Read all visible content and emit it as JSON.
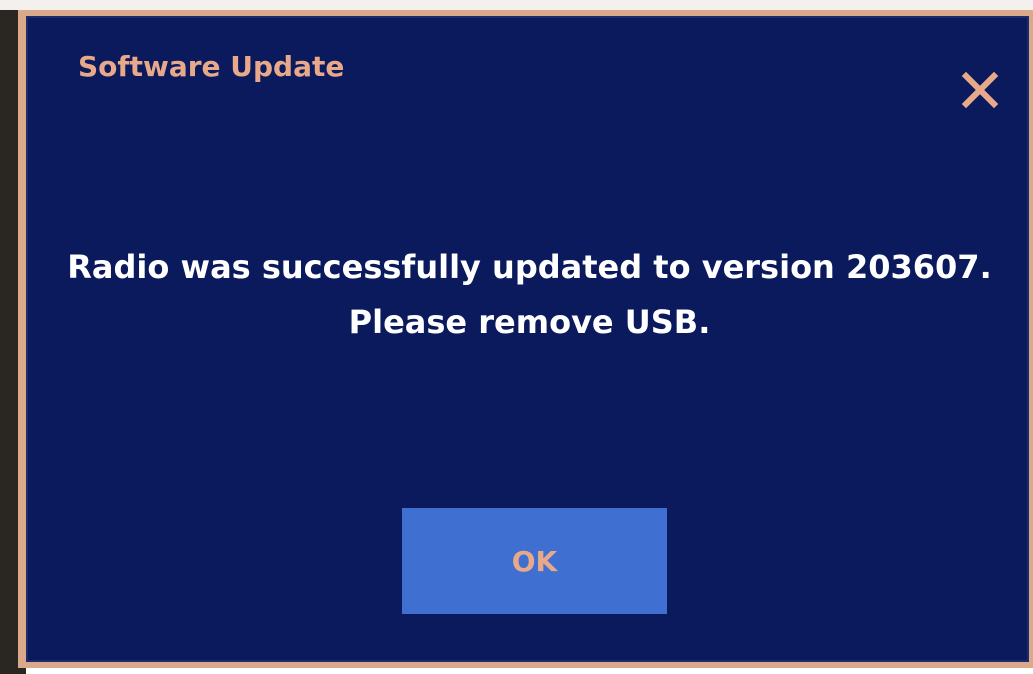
{
  "dialog": {
    "title": "Software Update",
    "message_line1": "Radio was successfully updated to version 203607.",
    "message_line2": "Please remove USB.",
    "ok_label": "OK",
    "close_icon": "close-icon"
  },
  "colors": {
    "dialog_background": "#0a1a5c",
    "title_text": "#e8a88a",
    "message_text": "#ffffff",
    "button_background": "#3f6fd1",
    "button_text": "#e8a88a",
    "frame": "#d9a98a"
  }
}
